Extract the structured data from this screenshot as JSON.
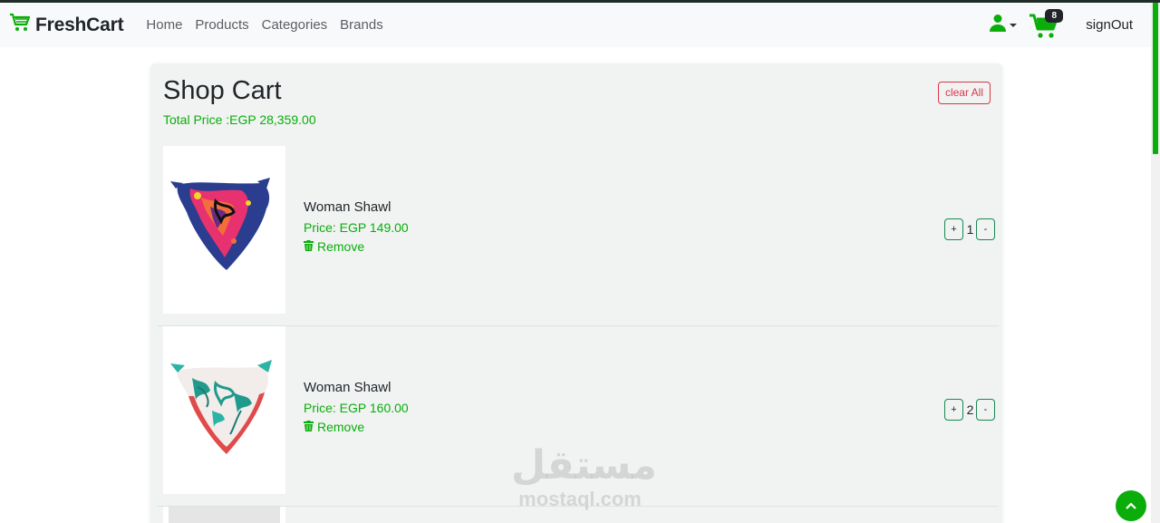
{
  "brand": {
    "name": "FreshCart",
    "logo_icon": "shopping-cart-icon",
    "accent": "#0aad0a"
  },
  "nav": {
    "links": [
      "Home",
      "Products",
      "Categories",
      "Brands"
    ],
    "user_icon": "user-icon",
    "cart_icon": "shopping-cart-icon",
    "cart_count": "8",
    "signout": "signOut"
  },
  "cart": {
    "title": "Shop Cart",
    "total_label": "Total Price :EGP 28,359.00",
    "clear_label": "clear All",
    "items": [
      {
        "name": "Woman Shawl",
        "price": "Price: EGP 149.00",
        "remove": "Remove",
        "quantity": "1",
        "plus": "+",
        "minus": "-"
      },
      {
        "name": "Woman Shawl",
        "price": "Price: EGP 160.00",
        "remove": "Remove",
        "quantity": "2",
        "plus": "+",
        "minus": "-"
      }
    ]
  },
  "watermark": {
    "arabic": "مستقل",
    "latin": "mostaql.com"
  },
  "colors": {
    "accent": "#0aad0a",
    "danger": "#dc3545",
    "card_bg": "#f0f3f2",
    "navbar_bg": "#f8f9fa"
  }
}
